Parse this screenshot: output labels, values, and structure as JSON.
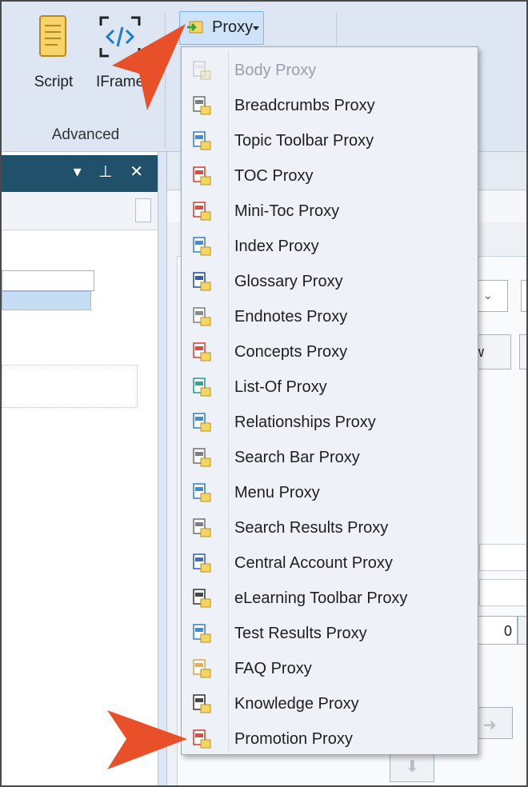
{
  "ribbon": {
    "script_label": "Script",
    "iframe_label": "IFrame",
    "group_label": "Advanced",
    "proxy_label": "Proxy"
  },
  "menu": {
    "items": [
      {
        "label": "Body Proxy",
        "icon": "body-proxy-icon",
        "disabled": true
      },
      {
        "label": "Breadcrumbs Proxy",
        "icon": "breadcrumbs-proxy-icon"
      },
      {
        "label": "Topic Toolbar Proxy",
        "icon": "topic-toolbar-proxy-icon"
      },
      {
        "label": "TOC Proxy",
        "icon": "toc-proxy-icon"
      },
      {
        "label": "Mini-Toc Proxy",
        "icon": "mini-toc-proxy-icon"
      },
      {
        "label": "Index Proxy",
        "icon": "index-proxy-icon"
      },
      {
        "label": "Glossary Proxy",
        "icon": "glossary-proxy-icon"
      },
      {
        "label": "Endnotes Proxy",
        "icon": "endnotes-proxy-icon"
      },
      {
        "label": "Concepts Proxy",
        "icon": "concepts-proxy-icon"
      },
      {
        "label": "List-Of Proxy",
        "icon": "list-of-proxy-icon"
      },
      {
        "label": "Relationships Proxy",
        "icon": "relationships-proxy-icon"
      },
      {
        "label": "Search Bar Proxy",
        "icon": "search-bar-proxy-icon"
      },
      {
        "label": "Menu Proxy",
        "icon": "menu-proxy-icon"
      },
      {
        "label": "Search Results Proxy",
        "icon": "search-results-proxy-icon"
      },
      {
        "label": "Central Account Proxy",
        "icon": "central-account-proxy-icon"
      },
      {
        "label": "eLearning Toolbar Proxy",
        "icon": "elearning-toolbar-proxy-icon"
      },
      {
        "label": "Test Results Proxy",
        "icon": "test-results-proxy-icon"
      },
      {
        "label": "FAQ Proxy",
        "icon": "faq-proxy-icon"
      },
      {
        "label": "Knowledge Proxy",
        "icon": "knowledge-proxy-icon"
      },
      {
        "label": "Promotion Proxy",
        "icon": "promotion-proxy-icon"
      }
    ]
  },
  "right_panel": {
    "button_partial": "ow",
    "spinner_value": "0"
  },
  "colors": {
    "ribbon_bg": "#dde6f2",
    "pane_header": "#21506b",
    "menu_bg": "#eef2f8",
    "callout_arrow": "#e8502a",
    "proxy_highlight": "#cfe3f8"
  }
}
